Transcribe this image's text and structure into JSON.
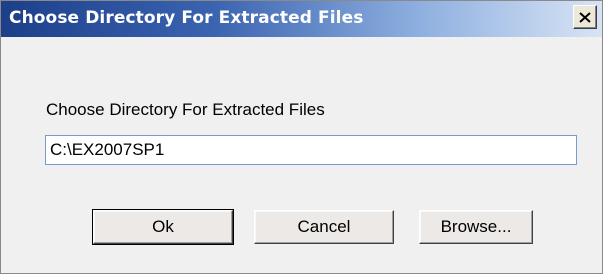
{
  "window": {
    "title": "Choose Directory For Extracted Files",
    "close_icon": "close-x-icon"
  },
  "form": {
    "label": "Choose Directory For Extracted Files",
    "path_value": "C:\\EX2007SP1"
  },
  "buttons": {
    "ok": "Ok",
    "cancel": "Cancel",
    "browse": "Browse..."
  },
  "colors": {
    "titlebar_start": "#1d3f8a",
    "titlebar_end": "#d8e4f5",
    "dialog_bg": "#f0f0f0"
  }
}
